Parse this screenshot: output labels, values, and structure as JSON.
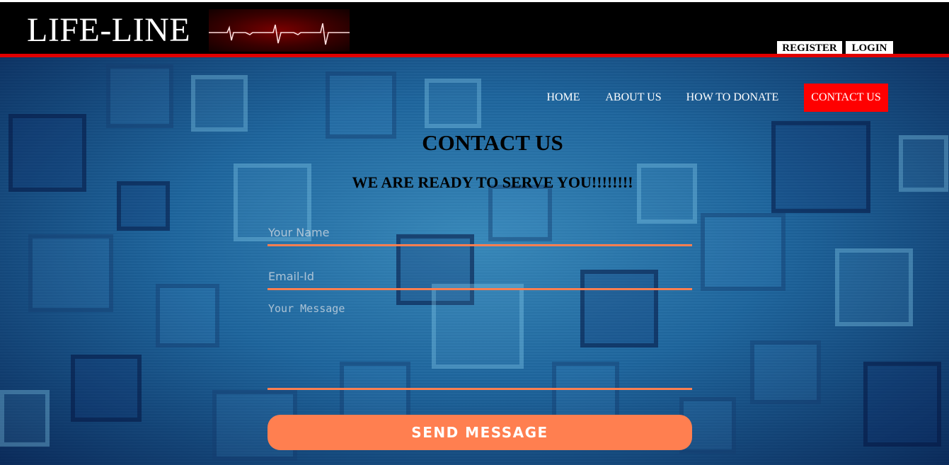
{
  "header": {
    "logo_text": "LIFE-LINE",
    "ecg_image": "ecg-heartbeat-icon",
    "register_label": "REGISTER",
    "login_label": "LOGIN"
  },
  "nav": {
    "items": [
      {
        "label": "HOME",
        "active": false
      },
      {
        "label": "ABOUT US",
        "active": false
      },
      {
        "label": "HOW TO DONATE",
        "active": false
      },
      {
        "label": "CONTACT US",
        "active": true
      }
    ]
  },
  "main": {
    "title": "CONTACT US",
    "subtitle": "WE ARE READY TO SERVE YOU!!!!!!!!",
    "form": {
      "name_placeholder": "Your Name",
      "email_placeholder": "Email-Id",
      "message_placeholder": "Your Message",
      "send_label": "SEND MESSAGE"
    }
  },
  "colors": {
    "header_bg": "#000000",
    "accent_red": "#ff0000",
    "field_underline": "#ff7f50",
    "send_button": "#ff7f50",
    "hero_bg": "#1a5f96"
  }
}
